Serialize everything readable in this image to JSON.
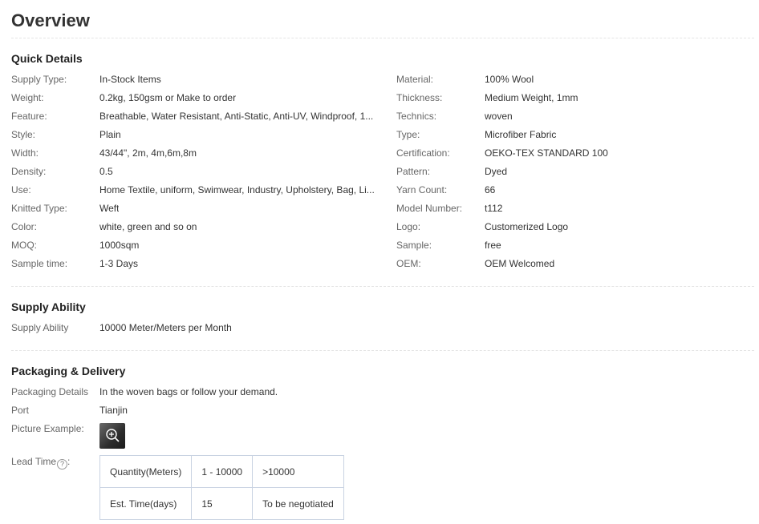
{
  "overview": {
    "title": "Overview"
  },
  "quick_details": {
    "title": "Quick Details",
    "left": [
      {
        "label": "Supply Type:",
        "value": "In-Stock Items"
      },
      {
        "label": "Weight:",
        "value": "0.2kg, 150gsm or Make to order"
      },
      {
        "label": "Feature:",
        "value": "Breathable, Water Resistant, Anti-Static, Anti-UV, Windproof, 1..."
      },
      {
        "label": "Style:",
        "value": "Plain"
      },
      {
        "label": "Width:",
        "value": "43/44\", 2m, 4m,6m,8m"
      },
      {
        "label": "Density:",
        "value": "0.5"
      },
      {
        "label": "Use:",
        "value": "Home Textile, uniform, Swimwear, Industry, Upholstery, Bag, Li..."
      },
      {
        "label": "Knitted Type:",
        "value": "Weft"
      },
      {
        "label": "Color:",
        "value": "white, green and so on"
      },
      {
        "label": "MOQ:",
        "value": "1000sqm"
      },
      {
        "label": "Sample time:",
        "value": "1-3 Days"
      }
    ],
    "right": [
      {
        "label": "Material:",
        "value": "100% Wool"
      },
      {
        "label": "Thickness:",
        "value": "Medium Weight, 1mm"
      },
      {
        "label": "Technics:",
        "value": "woven"
      },
      {
        "label": "Type:",
        "value": "Microfiber Fabric"
      },
      {
        "label": "Certification:",
        "value": "OEKO-TEX STANDARD 100"
      },
      {
        "label": "Pattern:",
        "value": "Dyed"
      },
      {
        "label": "Yarn Count:",
        "value": "66"
      },
      {
        "label": "Model Number:",
        "value": "t112"
      },
      {
        "label": "Logo:",
        "value": "Customerized Logo"
      },
      {
        "label": "Sample:",
        "value": "free"
      },
      {
        "label": "OEM:",
        "value": "OEM Welcomed"
      }
    ]
  },
  "supply_ability": {
    "title": "Supply Ability",
    "label": "Supply Ability",
    "value": "10000 Meter/Meters per Month"
  },
  "packaging": {
    "title": "Packaging & Delivery",
    "details_label": "Packaging Details",
    "details_value": "In the woven bags or follow your demand.",
    "port_label": "Port",
    "port_value": "Tianjin",
    "picture_label": "Picture Example:",
    "picture_icon": "zoom-in-icon",
    "lead_label": "Lead Time",
    "lead_help_icon": "question-icon",
    "lead_help_glyph": "?",
    "lead_colon": ":",
    "lead_table": [
      [
        "Quantity(Meters)",
        "1 - 10000",
        ">10000"
      ],
      [
        "Est. Time(days)",
        "15",
        "To be negotiated"
      ]
    ]
  }
}
